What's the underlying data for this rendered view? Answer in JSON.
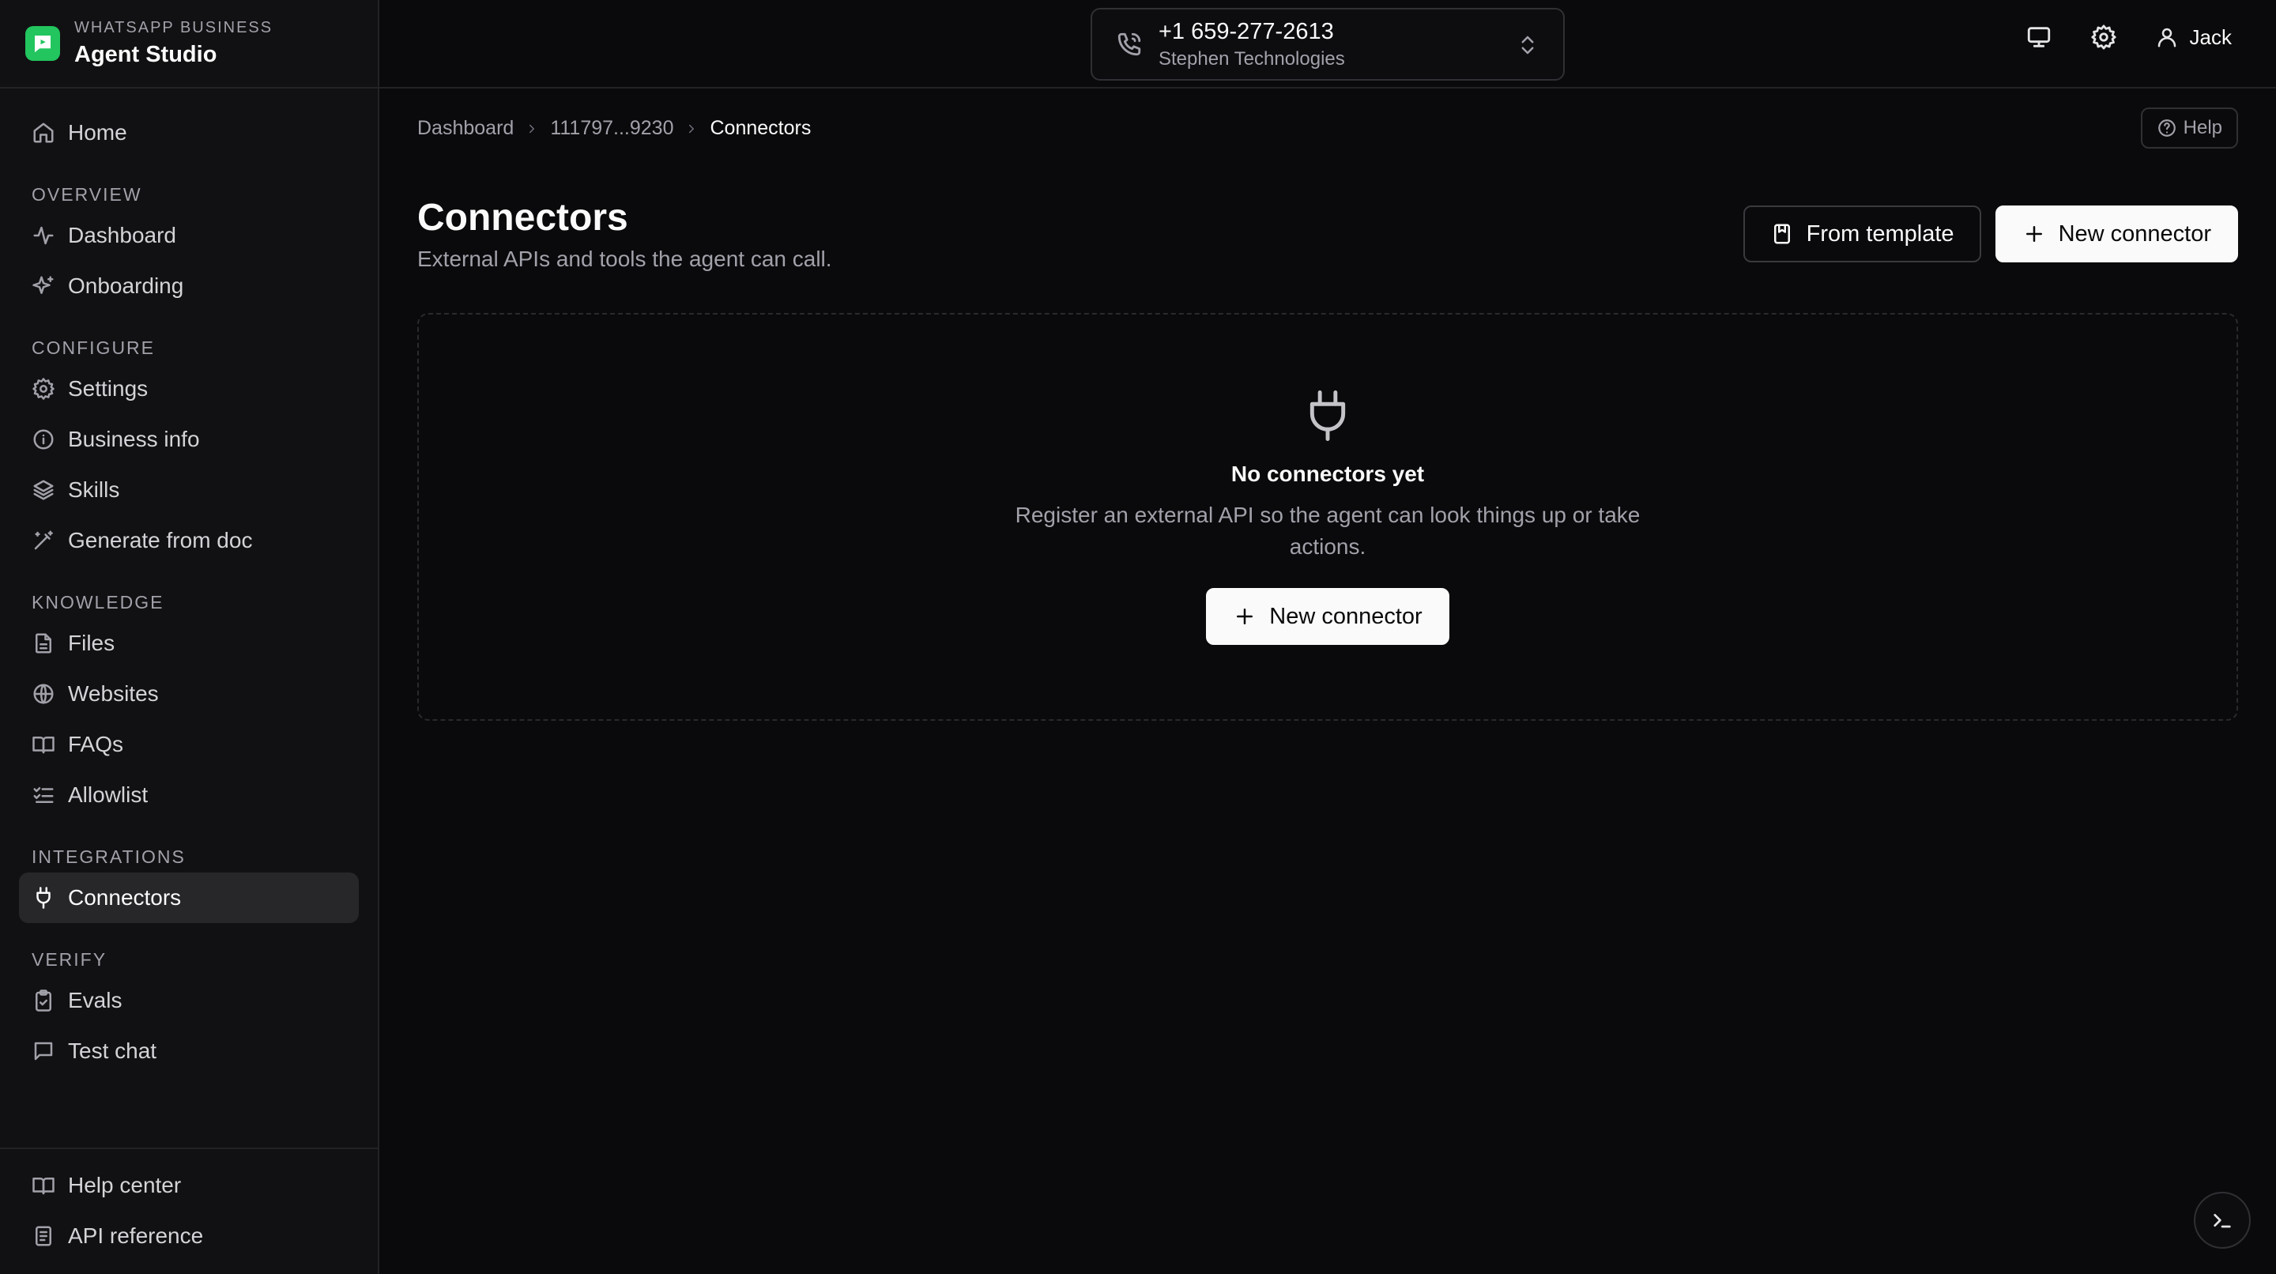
{
  "brand": {
    "subtitle": "WHATSAPP BUSINESS",
    "title": "Agent Studio",
    "accent": "#22c55e"
  },
  "sidebar": {
    "home": {
      "label": "Home",
      "icon": "home-icon"
    },
    "sections": [
      {
        "label": "OVERVIEW",
        "items": [
          {
            "label": "Dashboard",
            "icon": "activity-icon"
          },
          {
            "label": "Onboarding",
            "icon": "sparkles-icon"
          }
        ]
      },
      {
        "label": "CONFIGURE",
        "items": [
          {
            "label": "Settings",
            "icon": "gear-icon"
          },
          {
            "label": "Business info",
            "icon": "info-icon"
          },
          {
            "label": "Skills",
            "icon": "layers-icon"
          },
          {
            "label": "Generate from doc",
            "icon": "magic-wand-icon"
          }
        ]
      },
      {
        "label": "KNOWLEDGE",
        "items": [
          {
            "label": "Files",
            "icon": "file-icon"
          },
          {
            "label": "Websites",
            "icon": "globe-icon"
          },
          {
            "label": "FAQs",
            "icon": "book-icon"
          },
          {
            "label": "Allowlist",
            "icon": "list-checks-icon"
          }
        ]
      },
      {
        "label": "INTEGRATIONS",
        "items": [
          {
            "label": "Connectors",
            "icon": "plug-icon",
            "active": true
          }
        ]
      },
      {
        "label": "VERIFY",
        "items": [
          {
            "label": "Evals",
            "icon": "clipboard-check-icon"
          },
          {
            "label": "Test chat",
            "icon": "message-icon"
          }
        ]
      }
    ],
    "footer": [
      {
        "label": "Help center",
        "icon": "book-icon"
      },
      {
        "label": "API reference",
        "icon": "document-icon"
      }
    ]
  },
  "topbar": {
    "phone_number": "+1 659-277-2613",
    "organization": "Stephen Technologies",
    "user_name": "Jack"
  },
  "breadcrumb": {
    "root": "Dashboard",
    "middle": "111797...9230",
    "current": "Connectors"
  },
  "help_label": "Help",
  "page": {
    "title": "Connectors",
    "subtitle": "External APIs and tools the agent can call.",
    "from_template_label": "From template",
    "new_connector_label": "New connector"
  },
  "empty_state": {
    "title": "No connectors yet",
    "description": "Register an external API so the agent can look things up or take actions.",
    "button_label": "New connector"
  }
}
